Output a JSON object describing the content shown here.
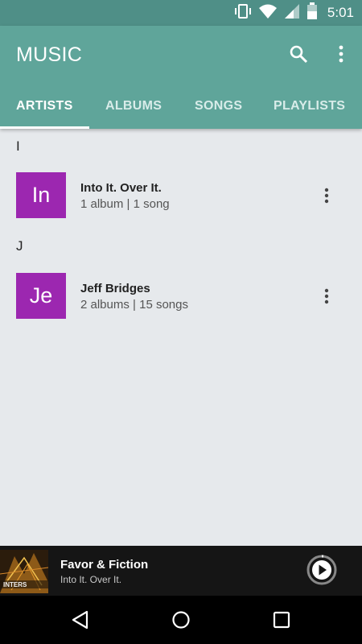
{
  "status_bar": {
    "time": "5:01",
    "icons": [
      "vibrate-icon",
      "wifi-icon",
      "signal-icon",
      "battery-icon"
    ]
  },
  "app_bar": {
    "title": "MUSIC",
    "actions": [
      "search-icon",
      "more-vert-icon"
    ],
    "tabs": [
      {
        "label": "ARTISTS",
        "active": true
      },
      {
        "label": "ALBUMS",
        "active": false
      },
      {
        "label": "SONGS",
        "active": false
      },
      {
        "label": "PLAYLISTS",
        "active": false
      }
    ]
  },
  "artists": [
    {
      "section": "I",
      "initials": "In",
      "name": "Into It. Over It.",
      "summary": "1 album | 1 song"
    },
    {
      "section": "J",
      "initials": "Je",
      "name": "Jeff Bridges",
      "summary": "2 albums | 15 songs"
    }
  ],
  "now_playing": {
    "title": "Favor & Fiction",
    "artist": "Into It. Over It.",
    "album_art_text": "INTERS"
  },
  "colors": {
    "status_bar": "#4f8f87",
    "app_bar": "#5fa59a",
    "avatar": "#9c27b0",
    "background": "#e6e9ec",
    "player": "#151515"
  },
  "nav_bar": [
    "back-icon",
    "home-icon",
    "recents-icon"
  ]
}
